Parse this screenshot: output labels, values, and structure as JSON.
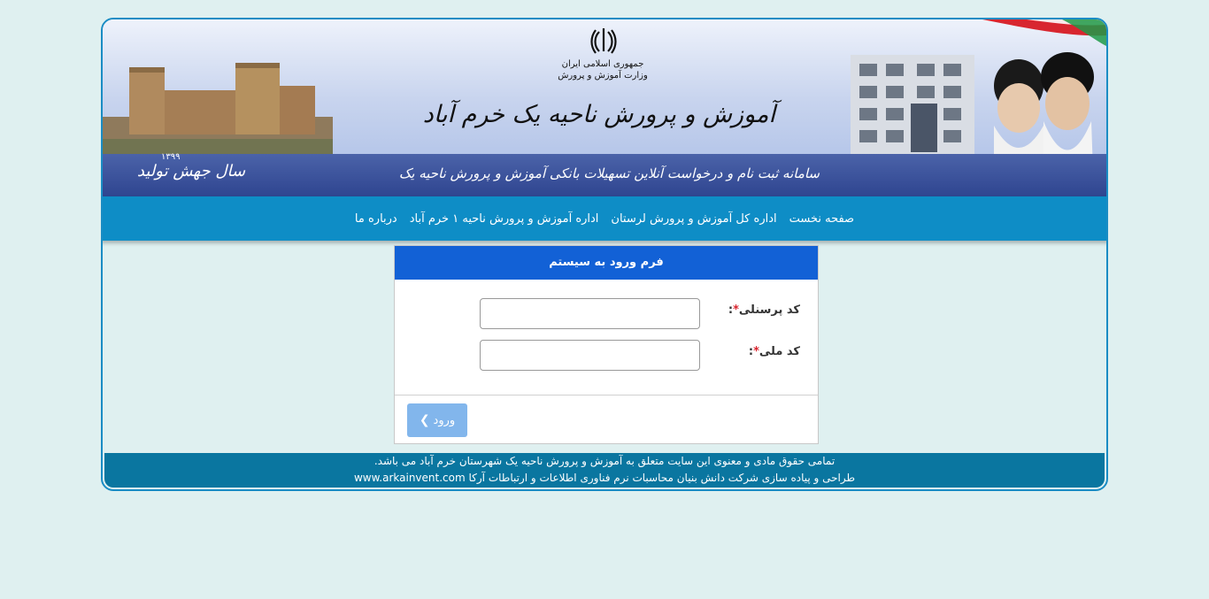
{
  "banner": {
    "emblem_icon": "iran-emblem-icon",
    "ministry_line1": "جمهوری اسلامی ایران",
    "ministry_line2": "وزارت آموزش و پرورش",
    "title": "آموزش و پرورش ناحیه یک خرم آباد",
    "subtitle": "سامانه ثبت نام و درخواست آنلاین تسهیلات بانکی آموزش و پرورش ناحیه یک",
    "slogan": "سال جهش تولید",
    "slogan_year": "۱۳۹۹"
  },
  "nav": {
    "items": [
      {
        "label": "صفحه نخست"
      },
      {
        "label": "اداره کل آموزش و پرورش لرستان"
      },
      {
        "label": "اداره آموزش و پرورش ناحیه ۱ خرم آباد"
      },
      {
        "label": "درباره ما"
      }
    ]
  },
  "login_form": {
    "title": "فرم ورود به سیستم",
    "personnel_code_label": "کد پرسنلی",
    "national_code_label": "کد ملی",
    "required_mark": "*",
    "label_suffix": ":",
    "personnel_code_value": "",
    "national_code_value": "",
    "submit_label": "ورود",
    "submit_icon": "chevron-left-icon"
  },
  "footer": {
    "line1": "تمامی حقوق مادی و معنوی این سایت متعلق به آموزش و پرورش ناحیه یک شهرستان خرم آباد می باشد.",
    "line2_text": "طراحی و پیاده سازی شرکت دانش بنیان محاسبات نرم فناوری اطلاعات و ارتباطات آرکا",
    "line2_url": "www.arkainvent.com"
  },
  "colors": {
    "page_bg": "#dff0f0",
    "frame_border": "#1a8cc4",
    "nav_bg": "#0e8dc6",
    "panel_head": "#1261d6",
    "button": "#82b6ec",
    "footer_bg": "#0a76a0",
    "required": "#d9232d"
  }
}
